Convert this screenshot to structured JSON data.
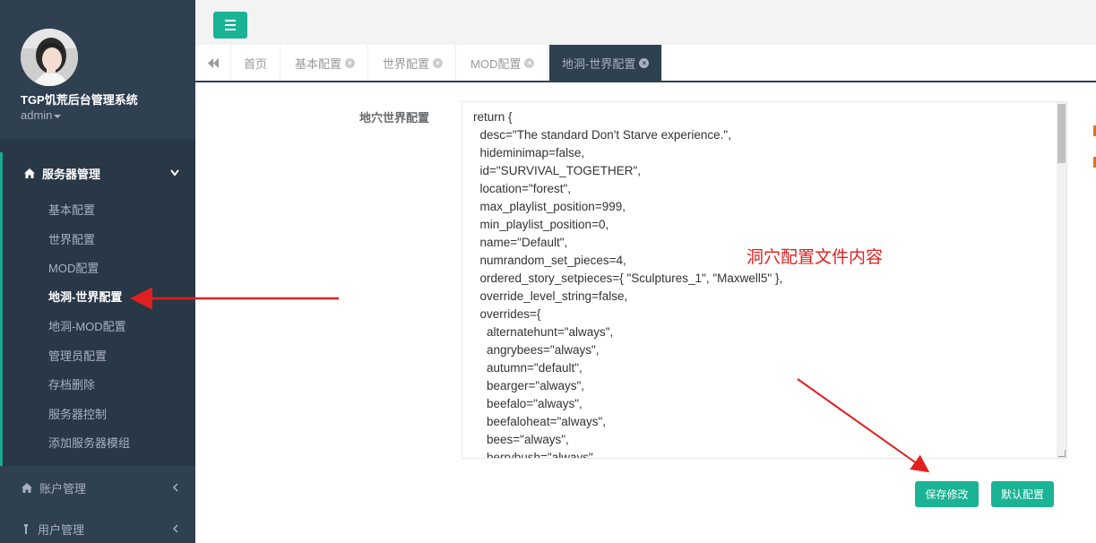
{
  "sidebar": {
    "app_title": "TGP饥荒后台管理系统",
    "user": "admin",
    "server_group": {
      "label": "服务器管理",
      "items": [
        {
          "label": "基本配置"
        },
        {
          "label": "世界配置"
        },
        {
          "label": "MOD配置"
        },
        {
          "label": "地洞-世界配置"
        },
        {
          "label": "地洞-MOD配置"
        },
        {
          "label": "管理员配置"
        },
        {
          "label": "存档删除"
        },
        {
          "label": "服务器控制"
        },
        {
          "label": "添加服务器模组"
        }
      ]
    },
    "other_groups": [
      {
        "label": "账户管理"
      },
      {
        "label": "用户管理"
      }
    ]
  },
  "tabs": [
    {
      "label": "首页"
    },
    {
      "label": "基本配置"
    },
    {
      "label": "世界配置"
    },
    {
      "label": "MOD配置"
    },
    {
      "label": "地洞-世界配置"
    }
  ],
  "form": {
    "label": "地穴世界配置",
    "content": "return {\n  desc=\"The standard Don't Starve experience.\",\n  hideminimap=false,\n  id=\"SURVIVAL_TOGETHER\",\n  location=\"forest\",\n  max_playlist_position=999,\n  min_playlist_position=0,\n  name=\"Default\",\n  numrandom_set_pieces=4,\n  ordered_story_setpieces={ \"Sculptures_1\", \"Maxwell5\" },\n  override_level_string=false,\n  overrides={\n    alternatehunt=\"always\",\n    angrybees=\"always\",\n    autumn=\"default\",\n    bearger=\"always\",\n    beefalo=\"always\",\n    beefaloheat=\"always\",\n    bees=\"always\",\n    berrybush=\"always\","
  },
  "buttons": {
    "save": "保存修改",
    "default": "默认配置"
  },
  "annotation": "洞穴配置文件内容",
  "colors": {
    "sidebar": "#2f4050",
    "accent": "#1ab394",
    "arrow": "#e02020"
  }
}
